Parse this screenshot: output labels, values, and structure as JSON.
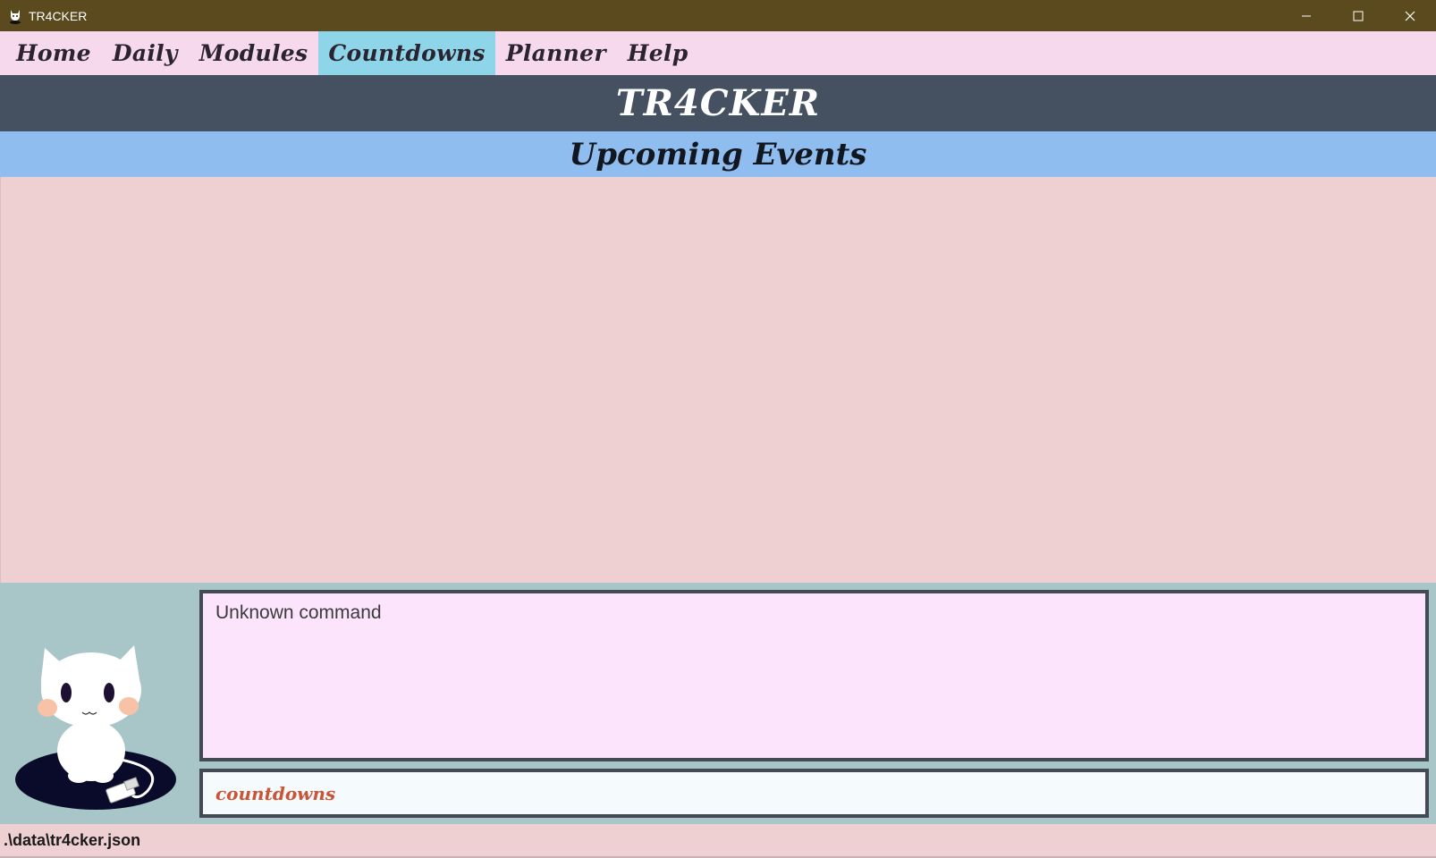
{
  "window": {
    "title": "TR4CKER",
    "icon": "cat-app-icon",
    "controls": {
      "minimize": "minimize-icon",
      "maximize": "maximize-icon",
      "close": "close-icon"
    }
  },
  "menu": {
    "items": [
      {
        "label": "Home",
        "active": false
      },
      {
        "label": "Daily",
        "active": false
      },
      {
        "label": "Modules",
        "active": false
      },
      {
        "label": "Countdowns",
        "active": true
      },
      {
        "label": "Planner",
        "active": false
      },
      {
        "label": "Help",
        "active": false
      }
    ]
  },
  "header": {
    "title": "TR4CKER"
  },
  "section": {
    "title": "Upcoming Events"
  },
  "result": {
    "text": "Unknown command"
  },
  "command": {
    "value": "countdowns"
  },
  "status": {
    "file_path": ".\\data\\tr4cker.json"
  },
  "colors": {
    "titlebar": "#5a4a1e",
    "menubar": "#f7d9ee",
    "menu_active": "#8fd5ea",
    "header": "#455160",
    "section_bar": "#8fbdf0",
    "content": "#eecfd2",
    "bottom_area": "#a8c6c8",
    "result_box": "#fce4fc",
    "command_box": "#f5fafc",
    "command_text": "#c95437"
  }
}
